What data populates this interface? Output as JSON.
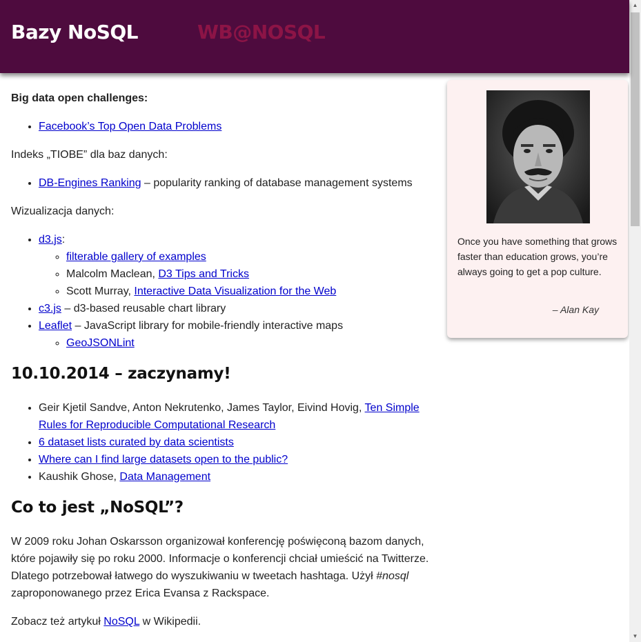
{
  "header": {
    "title": "Bazy NoSQL",
    "subtitle": "WB@NOSQL"
  },
  "main": {
    "s1_heading": "Big data open challenges:",
    "s1_link": "Facebook’s Top Open Data Problems",
    "s2_text": "Indeks „TIOBE” dla baz danych:",
    "s2_link": "DB-Engines Ranking",
    "s2_rest": " – popularity ranking of database management systems",
    "s3_text": "Wizualizacja danych:",
    "d3_link": "d3.js",
    "d3_colon": ":",
    "d3_sub1_link": "filterable gallery of examples",
    "d3_sub2_author": "Malcolm Maclean, ",
    "d3_sub2_link": "D3 Tips and Tricks",
    "d3_sub3_author": "Scott Murray, ",
    "d3_sub3_link": "Interactive Data Visualization for the Web",
    "c3_link": "c3.js",
    "c3_rest": " – d3-based reusable chart library",
    "leaflet_link": "Leaflet",
    "leaflet_rest": " – JavaScript library for mobile-friendly interactive maps",
    "leaflet_sub_link": "GeoJSONLint",
    "h_date": "10.10.2014 – zaczynamy!",
    "l1_authors": "Geir Kjetil Sandve, Anton Nekrutenko, James Taylor, Eivind Hovig, ",
    "l1_link": "Ten Simple Rules for Reproducible Computational Research",
    "l2_link": "6 dataset lists curated by data scientists",
    "l3_link": "Where can I find large datasets open to the public?",
    "l4_author": "Kaushik Ghose, ",
    "l4_link": "Data Management",
    "h_nosql": "Co to jest „NoSQL”?",
    "para1_a": "W 2009 roku Johan Oskarsson organizował konferencję poświęconą bazom danych, które pojawiły się po roku 2000. Informacje o konferencji chciał umieścić na Twitterze. Dlatego potrzebował łatwego do wyszukiwaniu w tweetach hashtaga. Użył ",
    "para1_em": "#nosql",
    "para1_b": " zaproponowanego przez Erica Evansa z Rackspace.",
    "para2_a": "Zobacz też artykuł ",
    "para2_link": "NoSQL",
    "para2_b": " w Wikipedii."
  },
  "sidebar": {
    "quote": "Once you have something that grows faster than education grows, you’re always going to get a pop culture.",
    "author": "– Alan Kay"
  },
  "scrollbar": {
    "up_arrow": "▲",
    "down_arrow": "▼"
  }
}
